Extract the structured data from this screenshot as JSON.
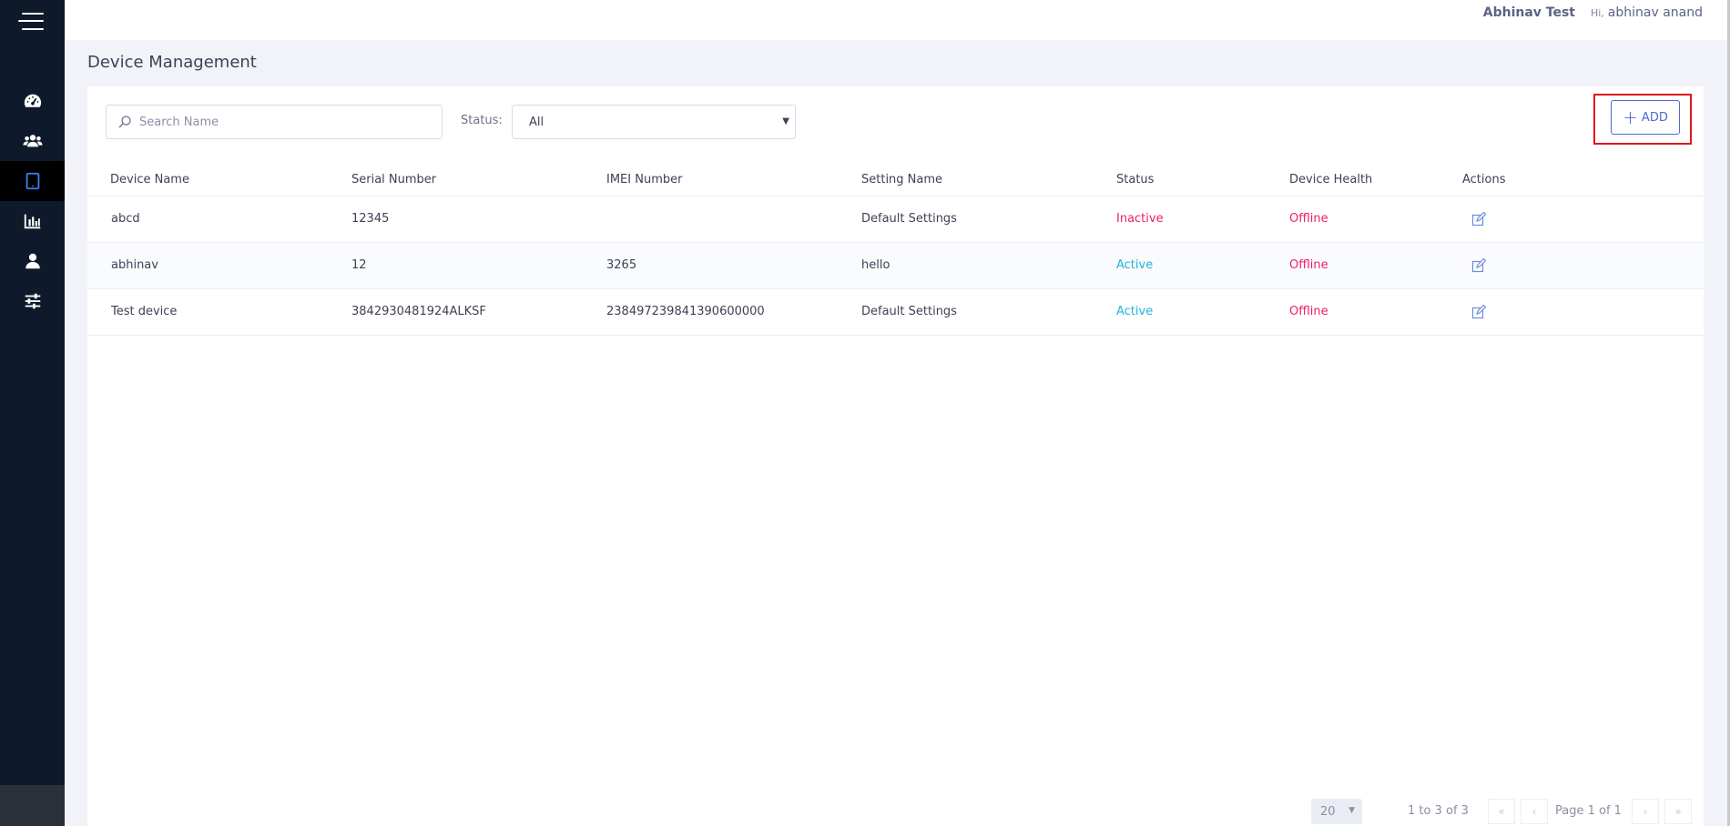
{
  "header": {
    "user_org": "Abhinav Test",
    "greeting_prefix": "Hi,",
    "user_name": "abhinav anand"
  },
  "sidebar": {
    "items": [
      {
        "name": "dashboard",
        "icon": "speedometer-icon"
      },
      {
        "name": "users",
        "icon": "users-icon"
      },
      {
        "name": "devices",
        "icon": "tablet-icon",
        "active": true
      },
      {
        "name": "reports",
        "icon": "bar-chart-icon"
      },
      {
        "name": "profile",
        "icon": "user-icon"
      },
      {
        "name": "settings",
        "icon": "sliders-icon"
      }
    ]
  },
  "page": {
    "title": "Device Management"
  },
  "filters": {
    "search_placeholder": "Search Name",
    "status_label": "Status:",
    "status_value": "All"
  },
  "toolbar": {
    "add_label": "ADD"
  },
  "table": {
    "columns": [
      "Device Name",
      "Serial Number",
      "IMEI Number",
      "Setting Name",
      "Status",
      "Device Health",
      "Actions"
    ],
    "rows": [
      {
        "device_name": "abcd",
        "serial": "12345",
        "imei": "",
        "setting": "Default Settings",
        "status": "Inactive",
        "health": "Offline"
      },
      {
        "device_name": "abhinav",
        "serial": "12",
        "imei": "3265",
        "setting": "hello",
        "status": "Active",
        "health": "Offline"
      },
      {
        "device_name": "Test device",
        "serial": "3842930481924ALKSF",
        "imei": "238497239841390600000",
        "setting": "Default Settings",
        "status": "Active",
        "health": "Offline"
      }
    ]
  },
  "pagination": {
    "page_size": "20",
    "range": "1 to 3 of 3",
    "page_info": "Page 1 of 1"
  },
  "colors": {
    "sidebar_bg": "#0e1a2b",
    "accent": "#4b6bd1",
    "inactive": "#ec1f66",
    "active": "#1fb4d8",
    "highlight": "#e1141b"
  }
}
